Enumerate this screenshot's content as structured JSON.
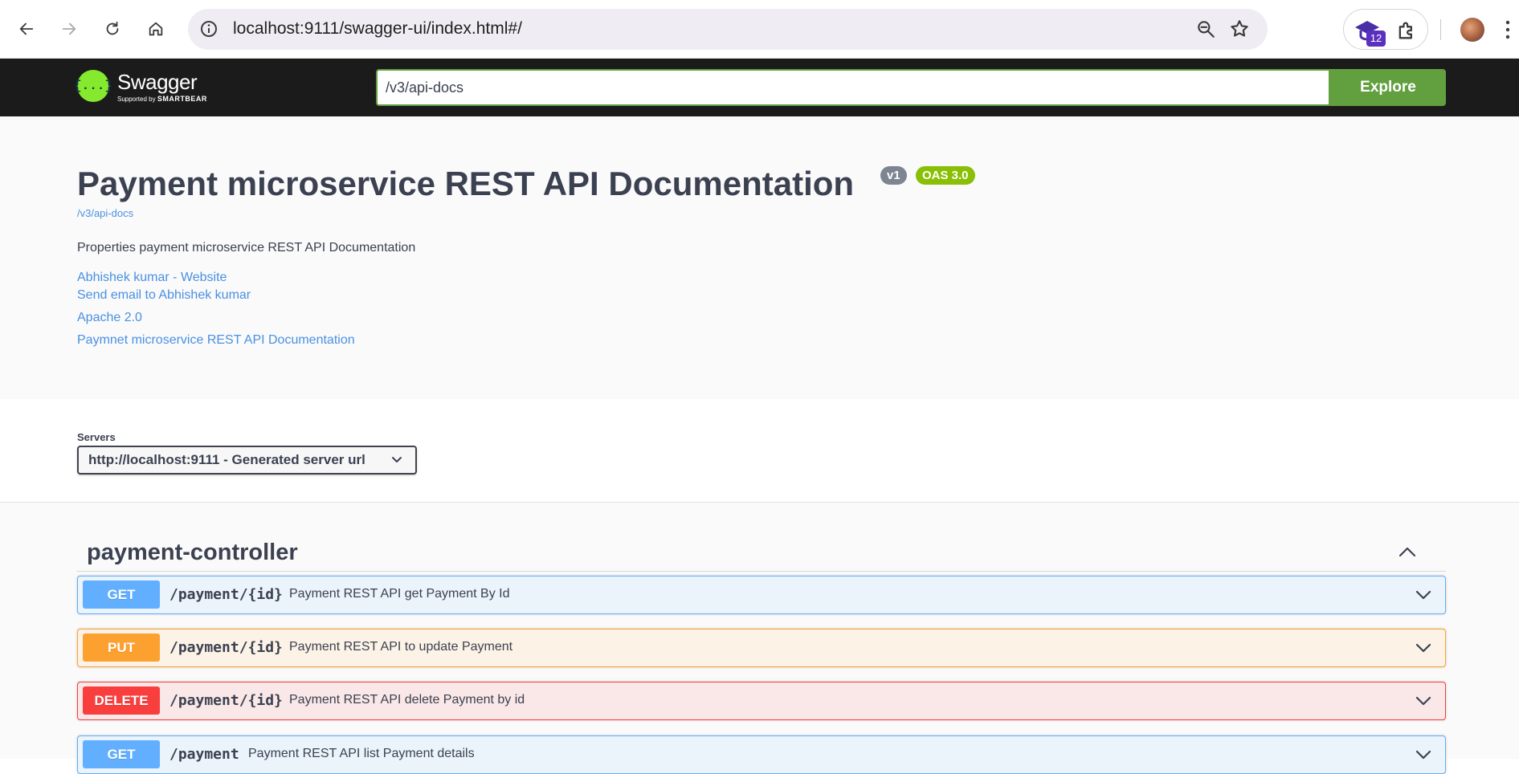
{
  "browser": {
    "url": "localhost:9111/swagger-ui/index.html#/",
    "extension_badge": "12"
  },
  "topbar": {
    "logo_symbol": "{...}",
    "logo_text": "Swagger",
    "logo_sub_prefix": "Supported by",
    "logo_sub_brand": "SMARTBEAR",
    "explore_value": "/v3/api-docs",
    "explore_label": "Explore"
  },
  "info": {
    "title": "Payment microservice REST API Documentation",
    "version_badge": "v1",
    "oas_badge": "OAS 3.0",
    "spec_link": "/v3/api-docs",
    "description": "Properties payment microservice REST API Documentation",
    "links": [
      "Abhishek kumar - Website",
      "Send email to Abhishek kumar",
      "Apache 2.0",
      "Paymnet microservice REST API Documentation"
    ]
  },
  "servers": {
    "label": "Servers",
    "selected": "http://localhost:9111 - Generated server url"
  },
  "tag": {
    "name": "payment-controller"
  },
  "operations": [
    {
      "method": "GET",
      "path": "/payment/{id}",
      "summary": "Payment REST API get Payment By Id"
    },
    {
      "method": "PUT",
      "path": "/payment/{id}",
      "summary": "Payment REST API to update Payment"
    },
    {
      "method": "DELETE",
      "path": "/payment/{id}",
      "summary": "Payment REST API delete Payment by id"
    },
    {
      "method": "GET",
      "path": "/payment",
      "summary": "Payment REST API list Payment details"
    }
  ],
  "colors": {
    "get": "#61affe",
    "put": "#fca130",
    "delete": "#f93e3e",
    "explore": "#62a03f",
    "oas": "#89bf04"
  }
}
